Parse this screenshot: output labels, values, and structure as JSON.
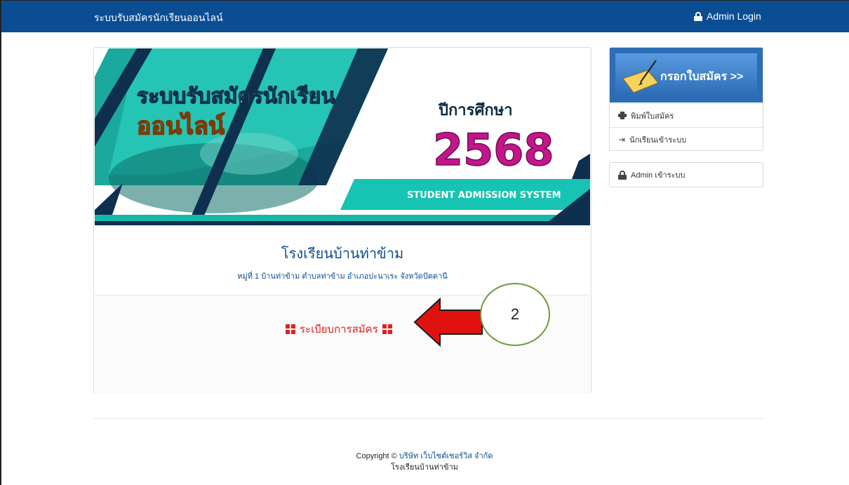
{
  "navbar": {
    "brand": "ระบบรับสมัครนักเรียนออนไลน์",
    "admin_login": "Admin Login"
  },
  "banner": {
    "title_line1": "ระบบรับสมัครนักเรียน",
    "title_line2": "ออนไลน์",
    "year_label": "ปีการศึกษา",
    "year": "2568",
    "subtitle": "STUDENT ADMISSION SYSTEM"
  },
  "school": {
    "name": "โรงเรียนบ้านท่าข้าม",
    "address": "หมู่ที่ 1 บ้านท่าข้าม ตำบลท่าข้าม อำเภอปะนาเระ จังหวัดปัตตานี"
  },
  "rules_link": "ระเบียบการสมัคร",
  "sidebar": {
    "apply_label": "กรอกใบสมัคร >>",
    "items": [
      {
        "label": "พิมพ์ใบสมัคร",
        "icon": "printer-icon"
      },
      {
        "label": "นักเรียนเข้าระบบ",
        "icon": "sign-in-icon"
      }
    ],
    "admin_label": "Admin เข้าระบบ"
  },
  "footer": {
    "copyright_prefix": "Copyright ©",
    "company": "บริษัท เว็บไซต์เซอร์วิส จำกัด",
    "school": "โรงเรียนบ้านท่าข้าม"
  },
  "annotation": {
    "number": "2",
    "arrow_color": "#e0120f",
    "circle_color": "#6f9a3e"
  },
  "colors": {
    "navbar": "#0b4d93",
    "accent_teal": "#14c2b4",
    "rules_red": "#e0211f"
  }
}
